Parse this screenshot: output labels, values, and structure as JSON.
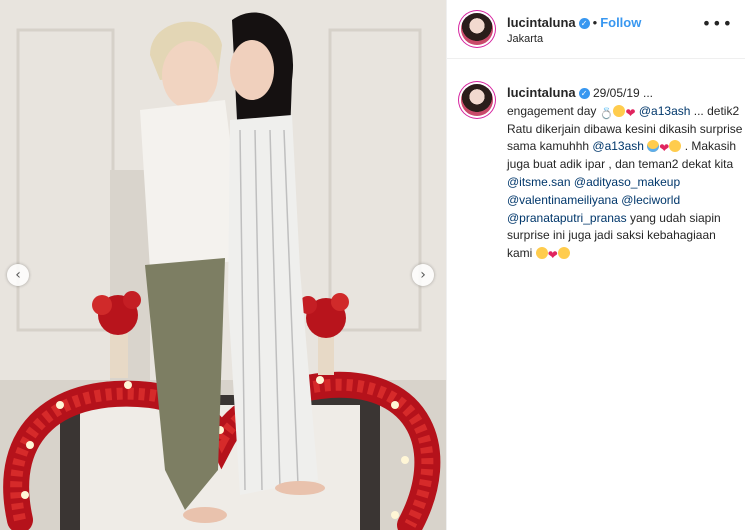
{
  "post": {
    "username": "lucintaluna",
    "location": "Jakarta",
    "follow_label": "Follow",
    "dot": "•",
    "more_icon": "•••",
    "prev_icon": "‹",
    "next_icon": "›"
  },
  "caption": {
    "username": "lucintaluna",
    "date": "29/05/19 ...",
    "segments": {
      "s1": "engagement day",
      "m1": "@a13ash",
      "s2": "...",
      "s3": "detik2 Ratu dikerjain dibawa kesini dikasih surprise sama kamuhhh",
      "m2": "@a13ash",
      "s4": ". Makasih juga buat adik ipar , dan teman2 dekat kita",
      "m3": "@itsme.san",
      "m4": "@adityaso_makeup",
      "m5": "@valentinameiliyana",
      "m6": "@leciworld",
      "m7": "@pranataputri_pranas",
      "s5": "yang udah siapin surprise ini juga jadi saksi kebahagiaan kami"
    },
    "heart": "❤",
    "ring": "💍"
  },
  "colors": {
    "accent": "#3897f0",
    "mention": "#00376b",
    "heart": "#e0245e"
  }
}
